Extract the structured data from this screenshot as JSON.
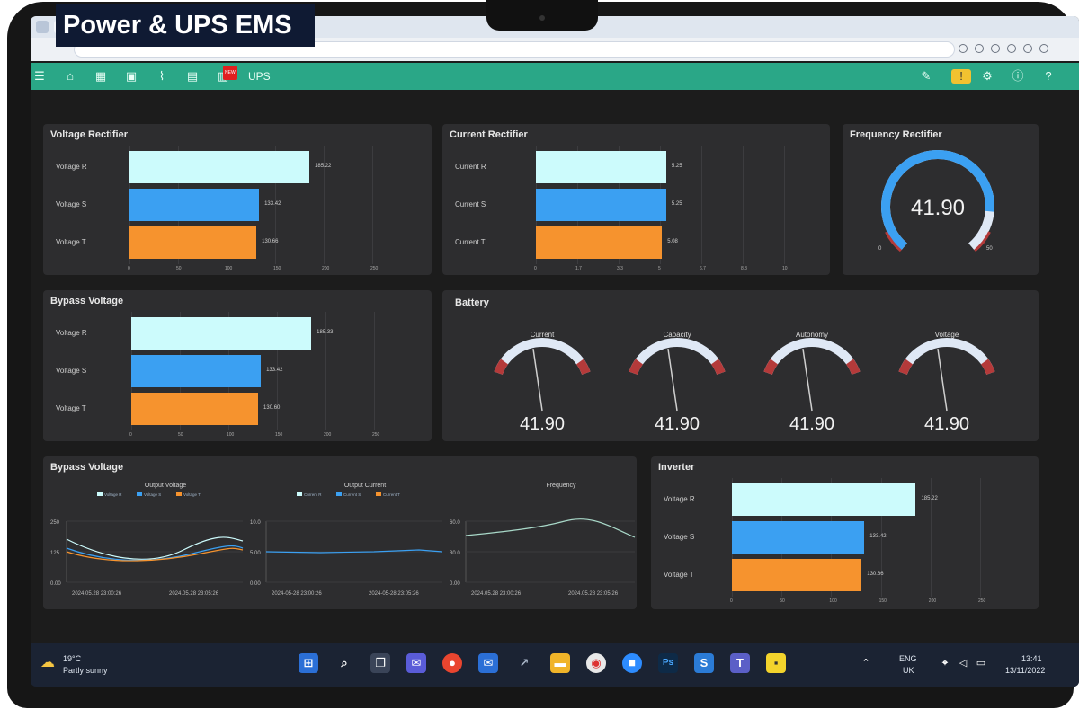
{
  "app": {
    "title": "Power & UPS EMS",
    "nav_label": "UPS",
    "nav_badge": "NEW"
  },
  "icons": [
    "menu-icon",
    "home-icon",
    "dashboard-icon",
    "calendar-icon",
    "chart-icon",
    "document-icon",
    "report-icon",
    "edit-icon",
    "alarm-icon",
    "gear-icon",
    "info-icon",
    "help-icon"
  ],
  "colors": {
    "nav": "#2aa787",
    "bar_r": "#ccfbfc",
    "bar_s": "#3ba0f2",
    "bar_t": "#f6932e",
    "panel": "#2d2d2f"
  },
  "voltage_rectifier": {
    "title": "Voltage Rectifier",
    "max": 250,
    "ticks": [
      "0",
      "50",
      "100",
      "150",
      "200",
      "250"
    ],
    "bars": [
      {
        "label": "Voltage R",
        "value": 185.22,
        "text": "185.22"
      },
      {
        "label": "Voltage S",
        "value": 133.42,
        "text": "133.42"
      },
      {
        "label": "Voltage T",
        "value": 130.66,
        "text": "130.66"
      }
    ]
  },
  "current_rectifier": {
    "title": "Current Rectifier",
    "max": 10,
    "ticks": [
      "0",
      "1.7",
      "3.3",
      "5",
      "6.7",
      "8.3",
      "10"
    ],
    "bars": [
      {
        "label": "Current R",
        "value": 5.25,
        "text": "5.25"
      },
      {
        "label": "Current S",
        "value": 5.25,
        "text": "5.25"
      },
      {
        "label": "Current T",
        "value": 5.08,
        "text": "5.08"
      }
    ]
  },
  "frequency_rectifier": {
    "title": "Frequency Rectifier",
    "value": "41.90",
    "fraction": 0.84,
    "min": "0",
    "max": "50"
  },
  "bypass_voltage_bars": {
    "title": "Bypass Voltage",
    "max": 250,
    "ticks": [
      "0",
      "50",
      "100",
      "150",
      "200",
      "250"
    ],
    "bars": [
      {
        "label": "Voltage R",
        "value": 185.33,
        "text": "185.33"
      },
      {
        "label": "Voltage S",
        "value": 133.42,
        "text": "133.42"
      },
      {
        "label": "Voltage T",
        "value": 130.6,
        "text": "130.60"
      }
    ]
  },
  "battery": {
    "title": "Battery",
    "gauges": [
      {
        "label": "Current",
        "value": "41.90",
        "fraction": 0.41
      },
      {
        "label": "Capacity",
        "value": "41.90",
        "fraction": 0.41
      },
      {
        "label": "Autonomy",
        "value": "41.90",
        "fraction": 0.41
      },
      {
        "label": "Voltage",
        "value": "41.90",
        "fraction": 0.41
      }
    ]
  },
  "bypass_trend": {
    "title": "Bypass Voltage",
    "charts": [
      {
        "title": "Output Voltage",
        "legend": [
          "Voltage R",
          "Voltage S",
          "Voltage T"
        ],
        "yticks": [
          "250",
          "125",
          "0.00"
        ],
        "xticks": [
          "2024.05.28 23:00:26",
          "2024.05.28 23:05:26"
        ]
      },
      {
        "title": "Output Current",
        "legend": [
          "Current R",
          "Current S",
          "Current T"
        ],
        "yticks": [
          "10.0",
          "5.00",
          "0.00"
        ],
        "xticks": [
          "2024-05-28 23:00:26",
          "2024-05-28 23:05:26"
        ]
      },
      {
        "title": "Frequency",
        "legend": [],
        "yticks": [
          "60.0",
          "30.0",
          "0.00"
        ],
        "xticks": [
          "2024.05.28 23:00:26",
          "2024.05.28 23:05:26"
        ]
      }
    ]
  },
  "inverter": {
    "title": "Inverter",
    "max": 250,
    "ticks": [
      "0",
      "50",
      "100",
      "150",
      "200",
      "250"
    ],
    "bars": [
      {
        "label": "Voltage R",
        "value": 185.22,
        "text": "185.22"
      },
      {
        "label": "Voltage S",
        "value": 133.42,
        "text": "133.42"
      },
      {
        "label": "Voltage T",
        "value": 130.66,
        "text": "130.66"
      }
    ]
  },
  "taskbar": {
    "weather_temp": "19°C",
    "weather_desc": "Partly sunny",
    "lang_top": "ENG",
    "lang_bottom": "UK",
    "time": "13:41",
    "date": "13/11/2022"
  }
}
